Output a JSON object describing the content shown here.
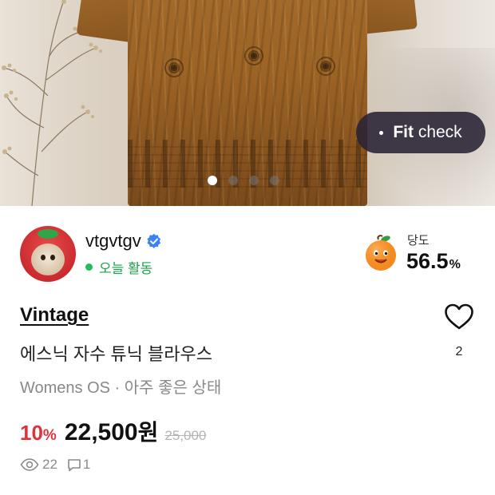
{
  "product_image": {
    "fit_check_label_bold": "Fit",
    "fit_check_label": "check",
    "carousel_total": 4,
    "carousel_active": 1
  },
  "seller": {
    "name": "vtgvtgv",
    "verified": true,
    "activity_status": "오늘 활동"
  },
  "sweetness": {
    "label": "당도",
    "value": "56.5",
    "unit": "%"
  },
  "listing": {
    "brand": "Vintage",
    "title": "에스닉 자수 튜닉 블라우스",
    "meta": "Womens OS · 아주 좋은 상태",
    "likes": "2"
  },
  "price": {
    "discount_value": "10",
    "discount_unit": "%",
    "current": "22,500",
    "currency": "원",
    "original": "25,000"
  },
  "stats": {
    "views": "22",
    "comments": "1"
  },
  "colors": {
    "accent_red": "#e0323b",
    "active_green": "#1aa34a",
    "verified_blue": "#3b82f6",
    "fit_check_bg": "#28223a"
  },
  "icons": {
    "verified": "verified-badge-icon",
    "heart": "heart-outline-icon",
    "views": "eye-icon",
    "comments": "comment-icon",
    "sweetness": "orange-character-icon"
  }
}
